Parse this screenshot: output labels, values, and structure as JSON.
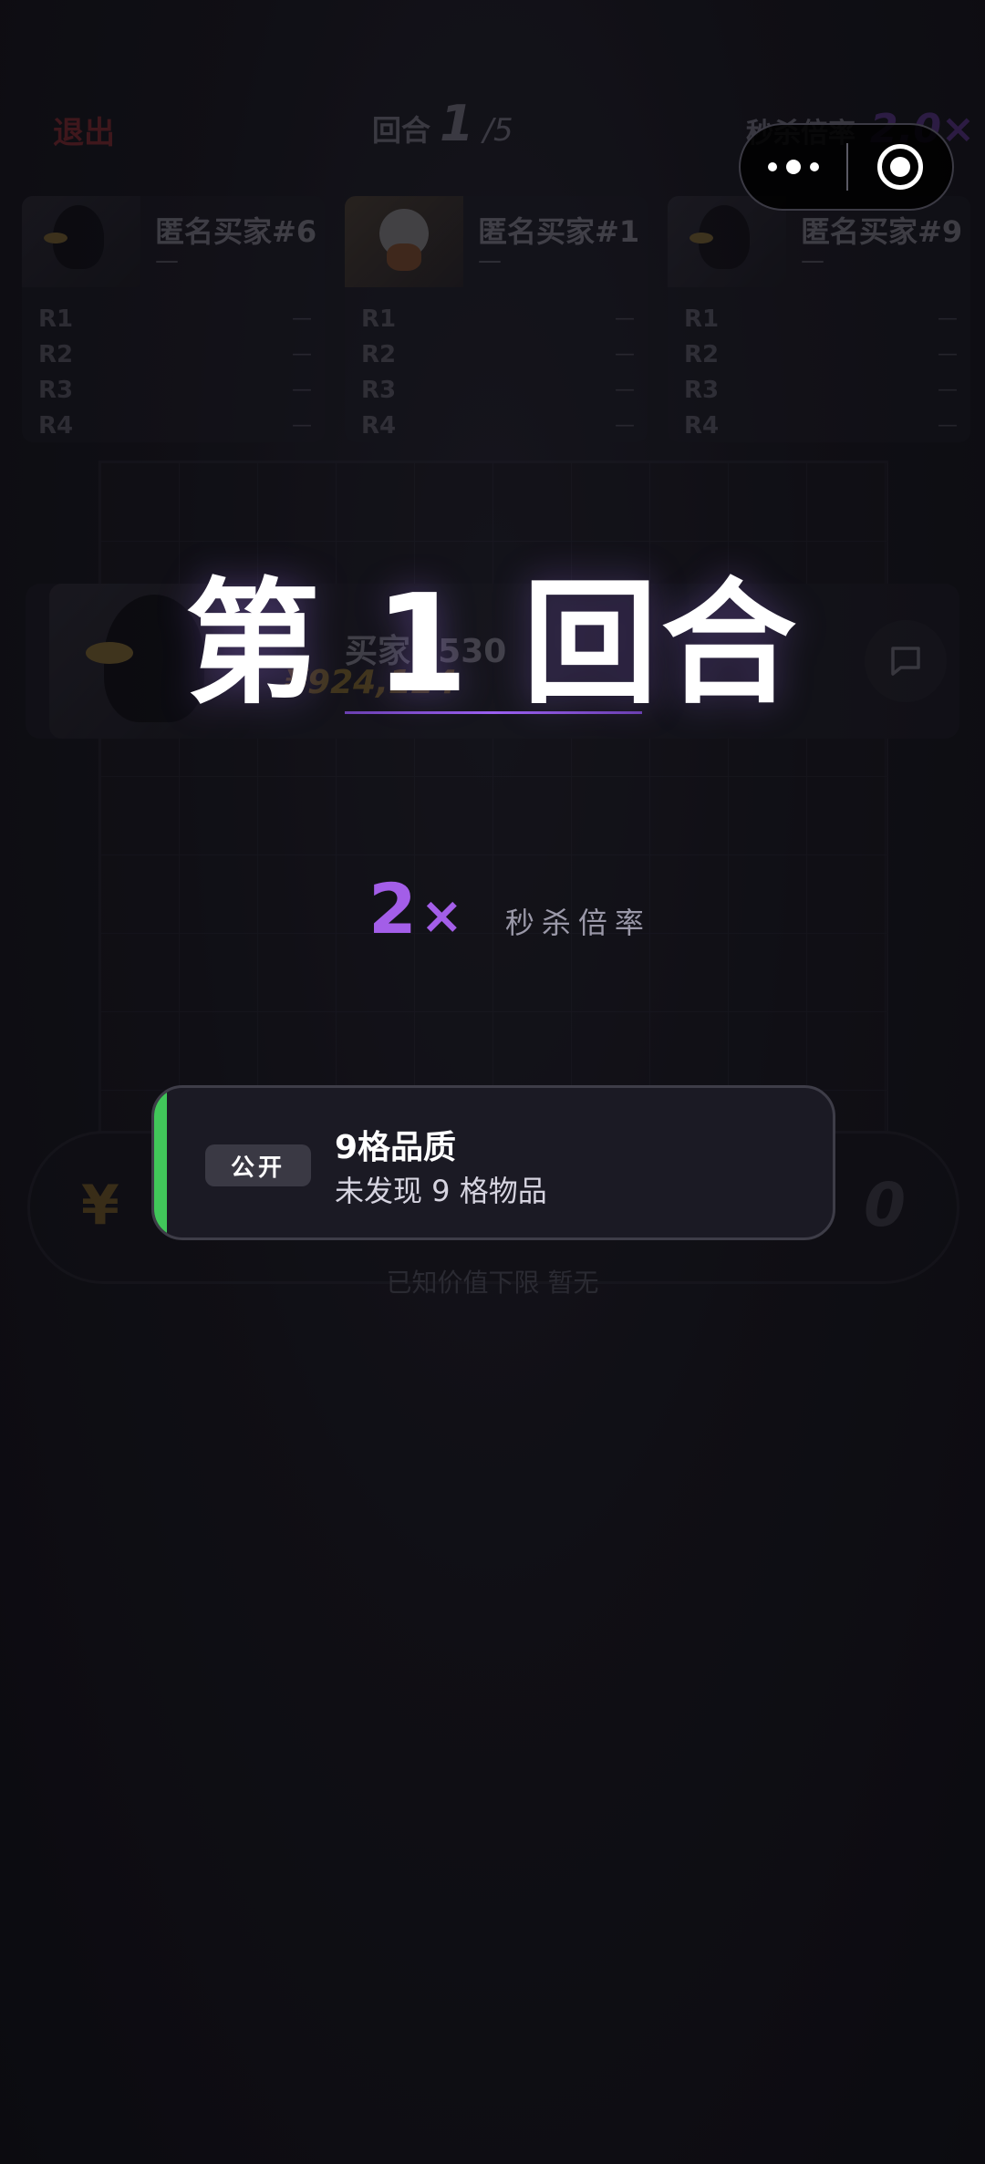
{
  "top_bar": {
    "exit_label": "退出",
    "round_label": "回合",
    "round_current": "1",
    "round_total": "/5",
    "multiplier_label": "秒杀倍率",
    "multiplier_value": "2.0×"
  },
  "players": [
    {
      "name": "匿名买家#6",
      "avatar": "raven-avatar",
      "status": "—",
      "rounds": [
        {
          "label": "R1",
          "value": "—"
        },
        {
          "label": "R2",
          "value": "—"
        },
        {
          "label": "R3",
          "value": "—"
        },
        {
          "label": "R4",
          "value": "—"
        }
      ]
    },
    {
      "name": "匿名买家#1",
      "avatar": "fox-avatar",
      "status": "—",
      "rounds": [
        {
          "label": "R1",
          "value": "—"
        },
        {
          "label": "R2",
          "value": "—"
        },
        {
          "label": "R3",
          "value": "—"
        },
        {
          "label": "R4",
          "value": "—"
        }
      ]
    },
    {
      "name": "匿名买家#9",
      "avatar": "raven-avatar",
      "status": "—",
      "rounds": [
        {
          "label": "R1",
          "value": "—"
        },
        {
          "label": "R2",
          "value": "—"
        },
        {
          "label": "R3",
          "value": "—"
        },
        {
          "label": "R4",
          "value": "—"
        }
      ]
    }
  ],
  "me": {
    "name": "买家#530",
    "money": "¥924,124"
  },
  "bid": {
    "currency": "¥",
    "value": "0",
    "known_value_text": "已知价值下限 暂无"
  },
  "announcement": {
    "round_title": "第 1 回合",
    "multiplier_number": "2",
    "multiplier_x": "×",
    "multiplier_caption": "秒杀倍率"
  },
  "notice": {
    "badge": "公开",
    "title": "9格品质",
    "subtitle": "未发现 9 格物品",
    "accent_color": "#41c75a"
  },
  "colors": {
    "accent_purple": "#a35ee8",
    "gold": "#d1a32f",
    "exit_red": "#d43a3a"
  }
}
